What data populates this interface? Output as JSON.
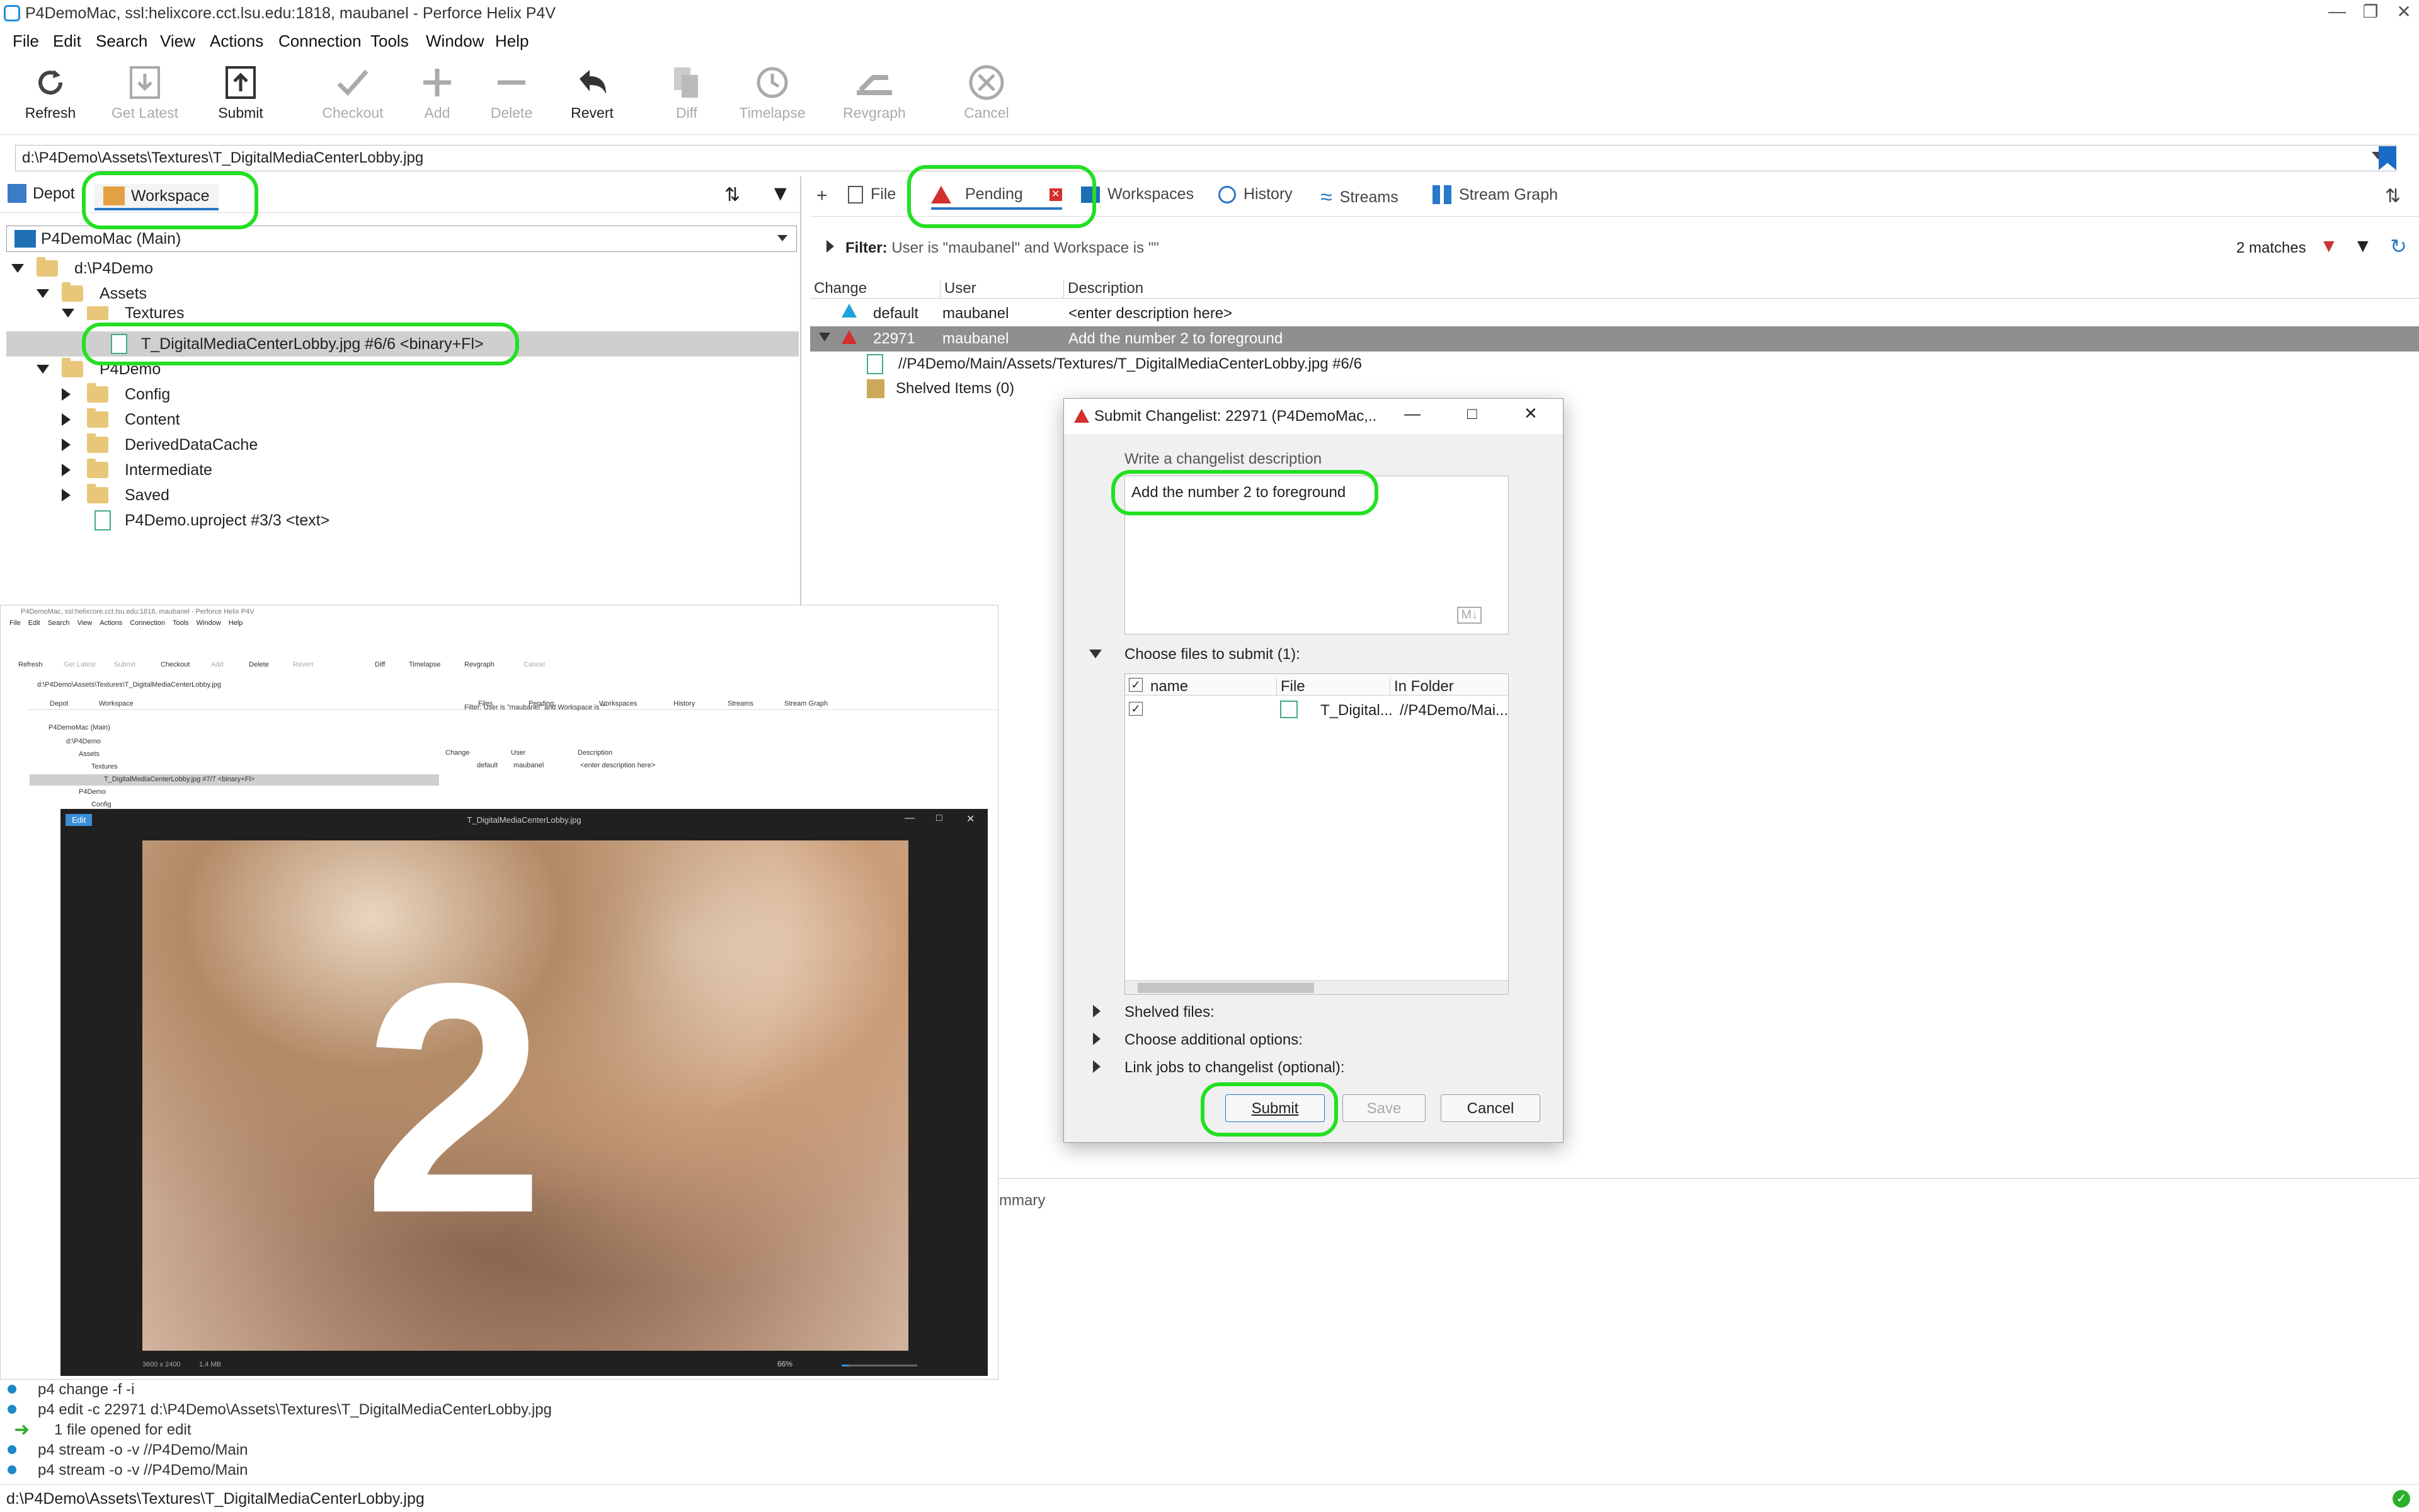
{
  "window": {
    "title": "P4DemoMac,  ssl:helixcore.cct.lsu.edu:1818,  maubanel - Perforce Helix P4V"
  },
  "menu": [
    "File",
    "Edit",
    "Search",
    "View",
    "Actions",
    "Connection",
    "Tools",
    "Window",
    "Help"
  ],
  "toolbar": [
    {
      "label": "Refresh",
      "enabled": true,
      "icon": "refresh-icon"
    },
    {
      "label": "Get Latest",
      "enabled": false,
      "icon": "download-icon"
    },
    {
      "label": "Submit",
      "enabled": true,
      "icon": "upload-icon"
    },
    {
      "label": "Checkout",
      "enabled": false,
      "icon": "check-icon"
    },
    {
      "label": "Add",
      "enabled": false,
      "icon": "plus-icon"
    },
    {
      "label": "Delete",
      "enabled": false,
      "icon": "minus-icon"
    },
    {
      "label": "Revert",
      "enabled": true,
      "icon": "undo-icon"
    },
    {
      "label": "Diff",
      "enabled": false,
      "icon": "diff-icon"
    },
    {
      "label": "Timelapse",
      "enabled": false,
      "icon": "clock-icon"
    },
    {
      "label": "Revgraph",
      "enabled": false,
      "icon": "graph-icon"
    },
    {
      "label": "Cancel",
      "enabled": false,
      "icon": "cancel-icon"
    }
  ],
  "path": "d:\\P4Demo\\Assets\\Textures\\T_DigitalMediaCenterLobby.jpg",
  "left": {
    "tabs": [
      "Depot",
      "Workspace"
    ],
    "workspace": "P4DemoMac (Main)",
    "tree": {
      "root": "d:\\P4Demo",
      "assets": "Assets",
      "textures": "Textures",
      "selected_file": "T_DigitalMediaCenterLobby.jpg #6/6 <binary+Fl>",
      "p4demo": "P4Demo",
      "children": [
        "Config",
        "Content",
        "DerivedDataCache",
        "Intermediate",
        "Saved"
      ],
      "uproject": "P4Demo.uproject #3/3 <text>"
    }
  },
  "right": {
    "tabs": [
      "Files",
      "Pending",
      "Workspaces",
      "History",
      "Streams",
      "Stream Graph"
    ],
    "filter_label": "Filter:",
    "filter_text": "User is \"maubanel\" and Workspace is \"\"",
    "matches": "2 matches",
    "columns": [
      "Change",
      "User",
      "Description"
    ],
    "rows": [
      {
        "change": "default",
        "user": "maubanel",
        "description": "<enter description here>"
      },
      {
        "change": "22971",
        "user": "maubanel",
        "description": "Add the number 2 to foreground"
      }
    ],
    "child_file": "//P4Demo/Main/Assets/Textures/T_DigitalMediaCenterLobby.jpg #6/6",
    "shelved": "Shelved Items (0)",
    "summary_tab": "mmary"
  },
  "dialog": {
    "title": "Submit Changelist: 22971 (P4DemoMac,...",
    "desc_label": "Write a changelist description",
    "description": "Add the number 2 to foreground",
    "md_badge": "M↓",
    "files_label": "Choose files to submit (1):",
    "file_columns": [
      "name",
      "File",
      "In Folder"
    ],
    "file_row": {
      "file": "T_Digital...",
      "folder": "//P4Demo/Mai..."
    },
    "sections": [
      "Shelved files:",
      "Choose additional options:",
      "Link jobs to changelist (optional):"
    ],
    "buttons": {
      "submit": "Submit",
      "save": "Save",
      "cancel": "Cancel"
    }
  },
  "viewer": {
    "title": "T_DigitalMediaCenterLobby.jpg",
    "edit": "Edit",
    "number": "2",
    "dims": "3600 x 2400",
    "size": "1.4 MB",
    "zoom": "66%"
  },
  "preview": {
    "title": "P4DemoMac,  ssl:helixcore.cct.lsu.edu:1818,  maubanel - Perforce Helix P4V",
    "menu": [
      "File",
      "Edit",
      "Search",
      "View",
      "Actions",
      "Connection",
      "Tools",
      "Window",
      "Help"
    ],
    "toolbar": [
      "Refresh",
      "Get Latest",
      "Submit",
      "Checkout",
      "Add",
      "Delete",
      "Revert",
      "Diff",
      "Timelapse",
      "Revgraph",
      "Cancel"
    ],
    "path": "d:\\P4Demo\\Assets\\Textures\\T_DigitalMediaCenterLobby.jpg",
    "left_tabs": [
      "Depot",
      "Workspace"
    ],
    "workspace": "P4DemoMac (Main)",
    "tree": [
      "d:\\P4Demo",
      "Assets",
      "Textures",
      "T_DigitalMediaCenterLobby.jpg #7/7 <binary+Fl>",
      "P4Demo",
      "Config"
    ],
    "right_tabs": [
      "Files",
      "Pending",
      "Workspaces",
      "History",
      "Streams",
      "Stream Graph"
    ],
    "filter": "Filter: User is \"maubanel\" and Workspace is \"\"",
    "columns": [
      "Change",
      "User",
      "Description"
    ],
    "row": {
      "change": "default",
      "user": "maubanel",
      "description": "<enter description here>"
    }
  },
  "log": [
    "p4 change -f -i",
    "p4 edit -c 22971 d:\\P4Demo\\Assets\\Textures\\T_DigitalMediaCenterLobby.jpg",
    "1 file opened for edit",
    "p4 stream -o -v //P4Demo/Main",
    "p4 stream -o -v //P4Demo/Main"
  ],
  "status": "d:\\P4Demo\\Assets\\Textures\\T_DigitalMediaCenterLobby.jpg",
  "colors": {
    "highlight": "#22e022",
    "pending": "#d32f2f",
    "accent": "#2a78c8"
  }
}
